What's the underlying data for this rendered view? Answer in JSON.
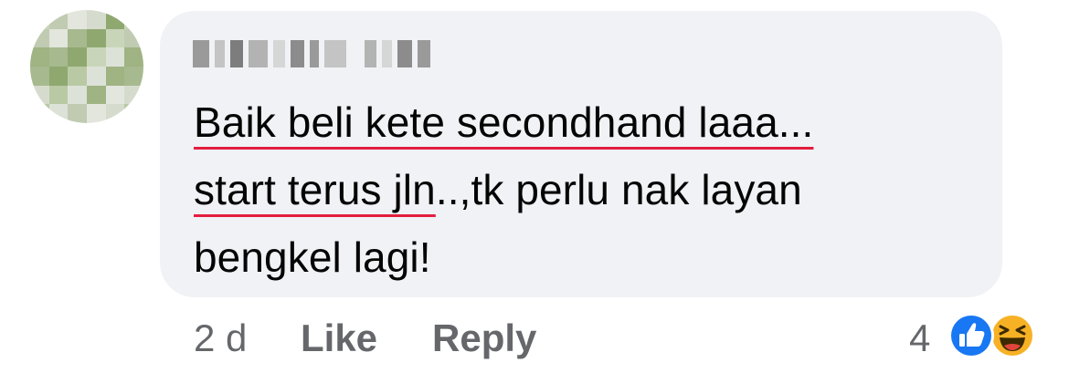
{
  "comment": {
    "lines": [
      {
        "underlined": "Baik beli kete secondhand laaa...",
        "rest": ""
      },
      {
        "underlined": "start terus jln",
        "rest": "..,tk perlu nak layan"
      },
      {
        "underlined": "",
        "rest": "bengkel lagi!"
      }
    ]
  },
  "meta": {
    "timestamp": "2 d",
    "like_label": "Like",
    "reply_label": "Reply",
    "reaction_count": "4"
  },
  "reactions": [
    "like-icon",
    "haha-icon"
  ],
  "colors": {
    "bubble": "#f0f2f5",
    "text": "#050505",
    "secondary_text": "#65676b",
    "spellcheck_underline": "#e41e3f",
    "like_blue": "#1877f2",
    "haha_yellow": "#f7b125"
  }
}
